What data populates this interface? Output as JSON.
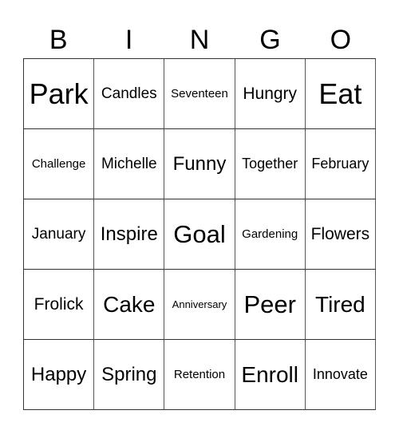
{
  "header": [
    "B",
    "I",
    "N",
    "G",
    "O"
  ],
  "cells": [
    [
      "Park",
      "Candles",
      "Seventeen",
      "Hungry",
      "Eat"
    ],
    [
      "Challenge",
      "Michelle",
      "Funny",
      "Together",
      "February"
    ],
    [
      "January",
      "Inspire",
      "Goal",
      "Gardening",
      "Flowers"
    ],
    [
      "Frolick",
      "Cake",
      "Anniversary",
      "Peer",
      "Tired"
    ],
    [
      "Happy",
      "Spring",
      "Retention",
      "Enroll",
      "Innovate"
    ]
  ]
}
